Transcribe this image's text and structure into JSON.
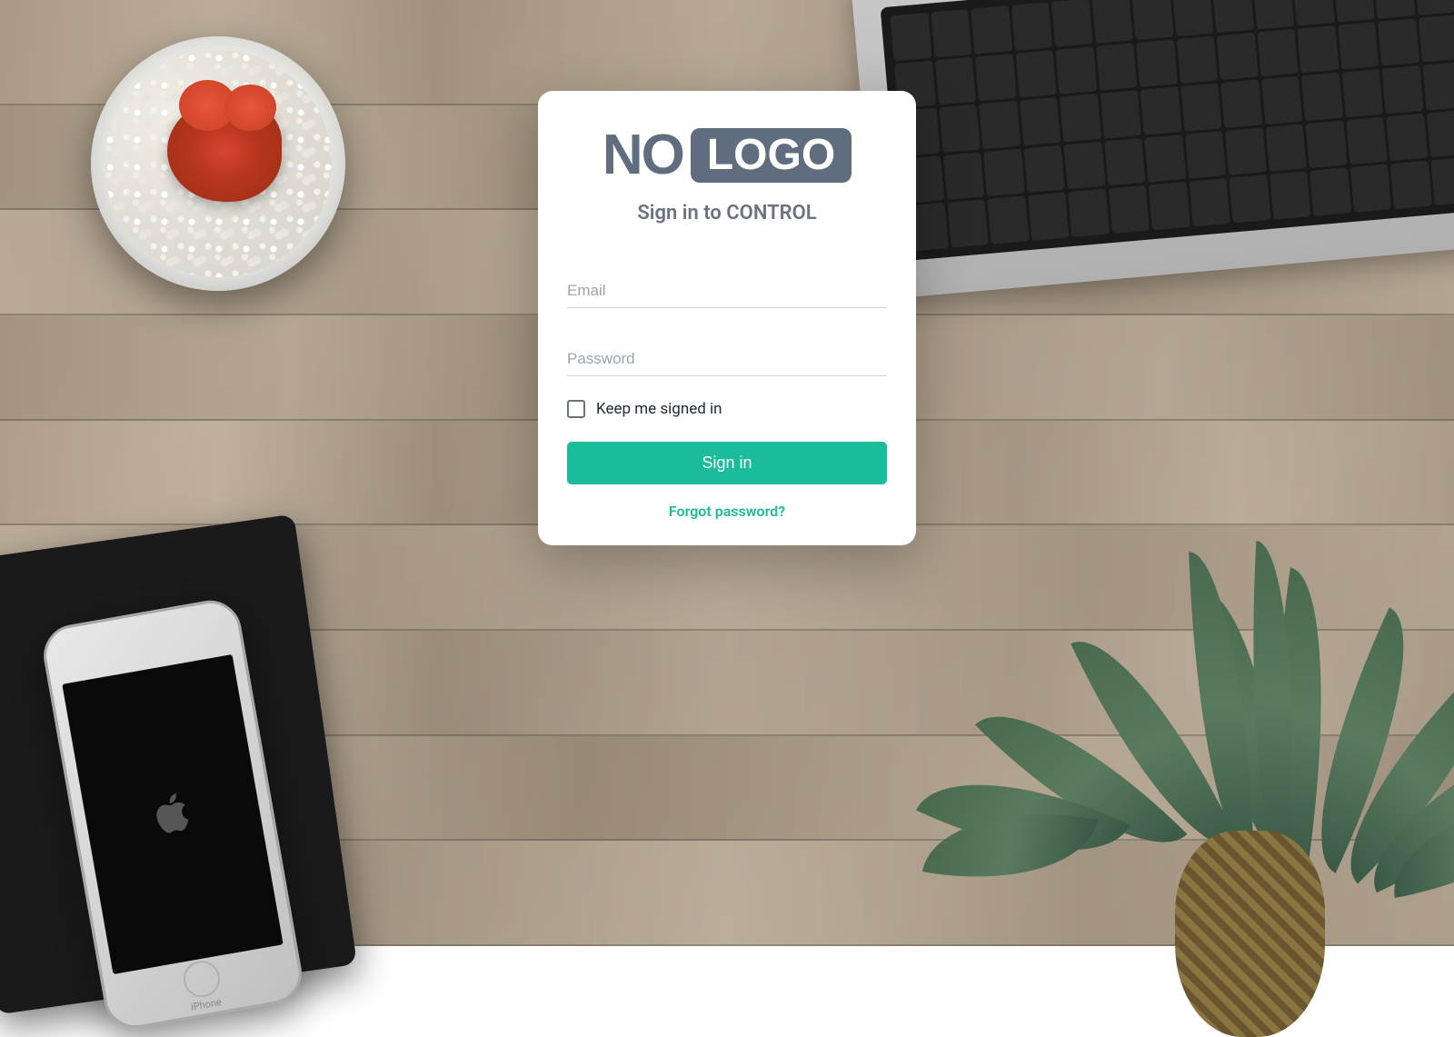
{
  "logo": {
    "part1": "NO",
    "part2": "LOGO"
  },
  "card": {
    "title": "Sign in to CONTROL",
    "email_placeholder": "Email",
    "password_placeholder": "Password",
    "remember_label": "Keep me signed in",
    "signin_button": "Sign in",
    "forgot_link": "Forgot password?"
  },
  "colors": {
    "accent": "#1abc9c",
    "logo_gray": "#5f6d7e"
  },
  "phone_label": "iPhone"
}
